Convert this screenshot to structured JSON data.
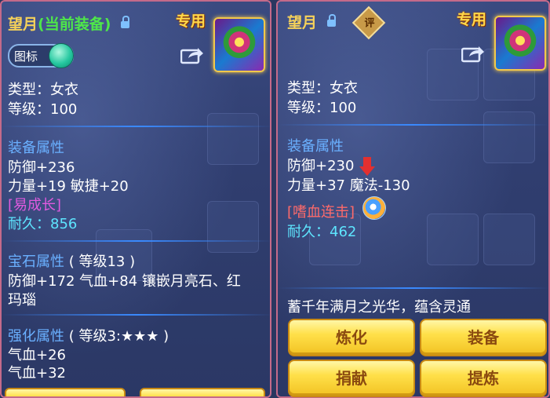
{
  "left": {
    "name": "望月",
    "current_tag": "(当前装备)",
    "exclusive": "专用",
    "icon_toggle_label": "图标",
    "type_line": "类型：女衣",
    "level_line": "等级：100",
    "equip_attr_head": "装备属性",
    "stat1": "防御+236",
    "stat2": "力量+19 敏捷+20",
    "special": "[易成长]",
    "durability_label": "耐久：",
    "durability_value": "856",
    "gem_head": "宝石属性",
    "gem_level": "( 等级13 )",
    "gem_stats": "防御+172 气血+84 镶嵌月亮石、红",
    "gem_stats2": "玛瑙",
    "enhance_head": "强化属性",
    "enhance_level": "( 等级3:★★★ )",
    "enhance1": "气血+26",
    "enhance2": "气血+32"
  },
  "right": {
    "name": "望月",
    "seal_label": "评",
    "exclusive": "专用",
    "type_line": "类型：女衣",
    "level_line": "等级：100",
    "equip_attr_head": "装备属性",
    "stat1": "防御+230",
    "stat2": "力量+37 魔法-130",
    "special": "[嗜血连击]",
    "durability_label": "耐久：",
    "durability_value": "462",
    "description": "蓄千年满月之光华，蕴含灵通",
    "btn_refine": "炼化",
    "btn_equip": "装备",
    "btn_donate": "捐献",
    "btn_extract": "提炼"
  },
  "colors": {
    "name": "#f5d15a",
    "current_tag": "#4ee64a",
    "section_head": "#6ab0ff",
    "special": "#e05adf",
    "durability": "#5ee6ff",
    "button": "#ffe04a"
  }
}
